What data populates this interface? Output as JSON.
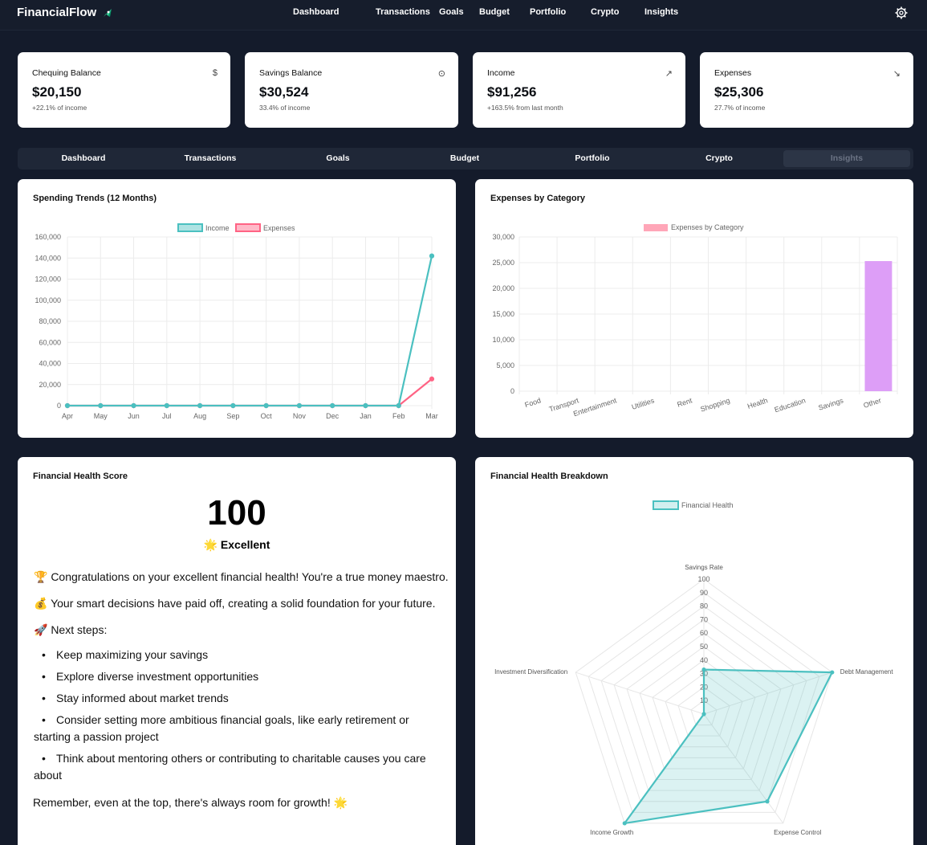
{
  "brand": {
    "name": "FinancialFlow",
    "logo_icon": "rocket-icon"
  },
  "top_nav": [
    "Dashboard",
    "Transactions",
    "Goals",
    "Budget",
    "Portfolio",
    "Crypto",
    "Insights"
  ],
  "stats": [
    {
      "label": "Chequing Balance",
      "value": "$20,150",
      "sub": "+22.1% of income",
      "icon": "$"
    },
    {
      "label": "Savings Balance",
      "value": "$30,524",
      "sub": "33.4% of income",
      "icon": "⊙"
    },
    {
      "label": "Income",
      "value": "$91,256",
      "sub": "+163.5% from last month",
      "icon": "↗"
    },
    {
      "label": "Expenses",
      "value": "$25,306",
      "sub": "27.7% of income",
      "icon": "↘"
    }
  ],
  "tabs": [
    "Dashboard",
    "Transactions",
    "Goals",
    "Budget",
    "Portfolio",
    "Crypto",
    "Insights"
  ],
  "active_tab": "Insights",
  "colors": {
    "income": "#4bc0c0",
    "expenses": "#ff6384",
    "category_bar": "#dd9ef7",
    "bg": "#141b2b"
  },
  "panels": {
    "spending_title": "Spending Trends (12 Months)",
    "category_title": "Expenses by Category",
    "score_title": "Financial Health Score",
    "breakdown_title": "Financial Health Breakdown"
  },
  "health": {
    "score": "100",
    "rating": "🌟 Excellent",
    "line1": "🏆 Congratulations on your excellent financial health! You're a true money maestro.",
    "line2": "💰 Your smart decisions have paid off, creating a solid foundation for your future.",
    "line3": "🚀 Next steps:",
    "bullets": [
      "Keep maximizing your savings",
      "Explore diverse investment opportunities",
      "Stay informed about market trends",
      "Consider setting more ambitious financial goals, like early retirement or starting a passion project",
      "Think about mentoring others or contributing to charitable causes you care about"
    ],
    "closing": "Remember, even at the top, there's always room for growth! 🌟"
  },
  "chart_data": [
    {
      "type": "line",
      "title": "Spending Trends (12 Months)",
      "x": [
        "Apr",
        "May",
        "Jun",
        "Jul",
        "Aug",
        "Sep",
        "Oct",
        "Nov",
        "Dec",
        "Jan",
        "Feb",
        "Mar"
      ],
      "series": [
        {
          "name": "Income",
          "values": [
            0,
            0,
            0,
            0,
            0,
            0,
            0,
            0,
            0,
            0,
            0,
            142000
          ]
        },
        {
          "name": "Expenses",
          "values": [
            0,
            0,
            0,
            0,
            0,
            0,
            0,
            0,
            0,
            0,
            0,
            25306
          ]
        }
      ],
      "ylim": [
        0,
        160000
      ],
      "yticks": [
        "160,000",
        "140,000",
        "120,000",
        "100,000",
        "80,000",
        "60,000",
        "40,000",
        "20,000",
        "0"
      ],
      "grid": true,
      "legend": "top"
    },
    {
      "type": "bar",
      "title": "Expenses by Category",
      "categories": [
        "Food",
        "Transport",
        "Entertainment",
        "Utilities",
        "Rent",
        "Shopping",
        "Health",
        "Education",
        "Savings",
        "Other"
      ],
      "series": [
        {
          "name": "Expenses by Category",
          "values": [
            0,
            0,
            0,
            0,
            0,
            0,
            0,
            0,
            0,
            25306
          ]
        }
      ],
      "ylim": [
        0,
        30000
      ],
      "yticks": [
        "30,000",
        "25,000",
        "20,000",
        "15,000",
        "10,000",
        "5,000",
        "0"
      ],
      "grid": true,
      "legend": "top"
    },
    {
      "type": "radar",
      "title": "Financial Health Breakdown",
      "axes": [
        "Savings Rate",
        "Debt Management",
        "Expense Control",
        "Income Growth",
        "Investment Diversification"
      ],
      "series": [
        {
          "name": "Financial Health",
          "values": [
            33,
            100,
            80,
            100,
            0
          ]
        }
      ],
      "rticks": [
        "100",
        "90",
        "80",
        "70",
        "60",
        "50",
        "40",
        "30",
        "20",
        "10"
      ],
      "range": [
        0,
        100
      ],
      "legend": "top"
    }
  ]
}
